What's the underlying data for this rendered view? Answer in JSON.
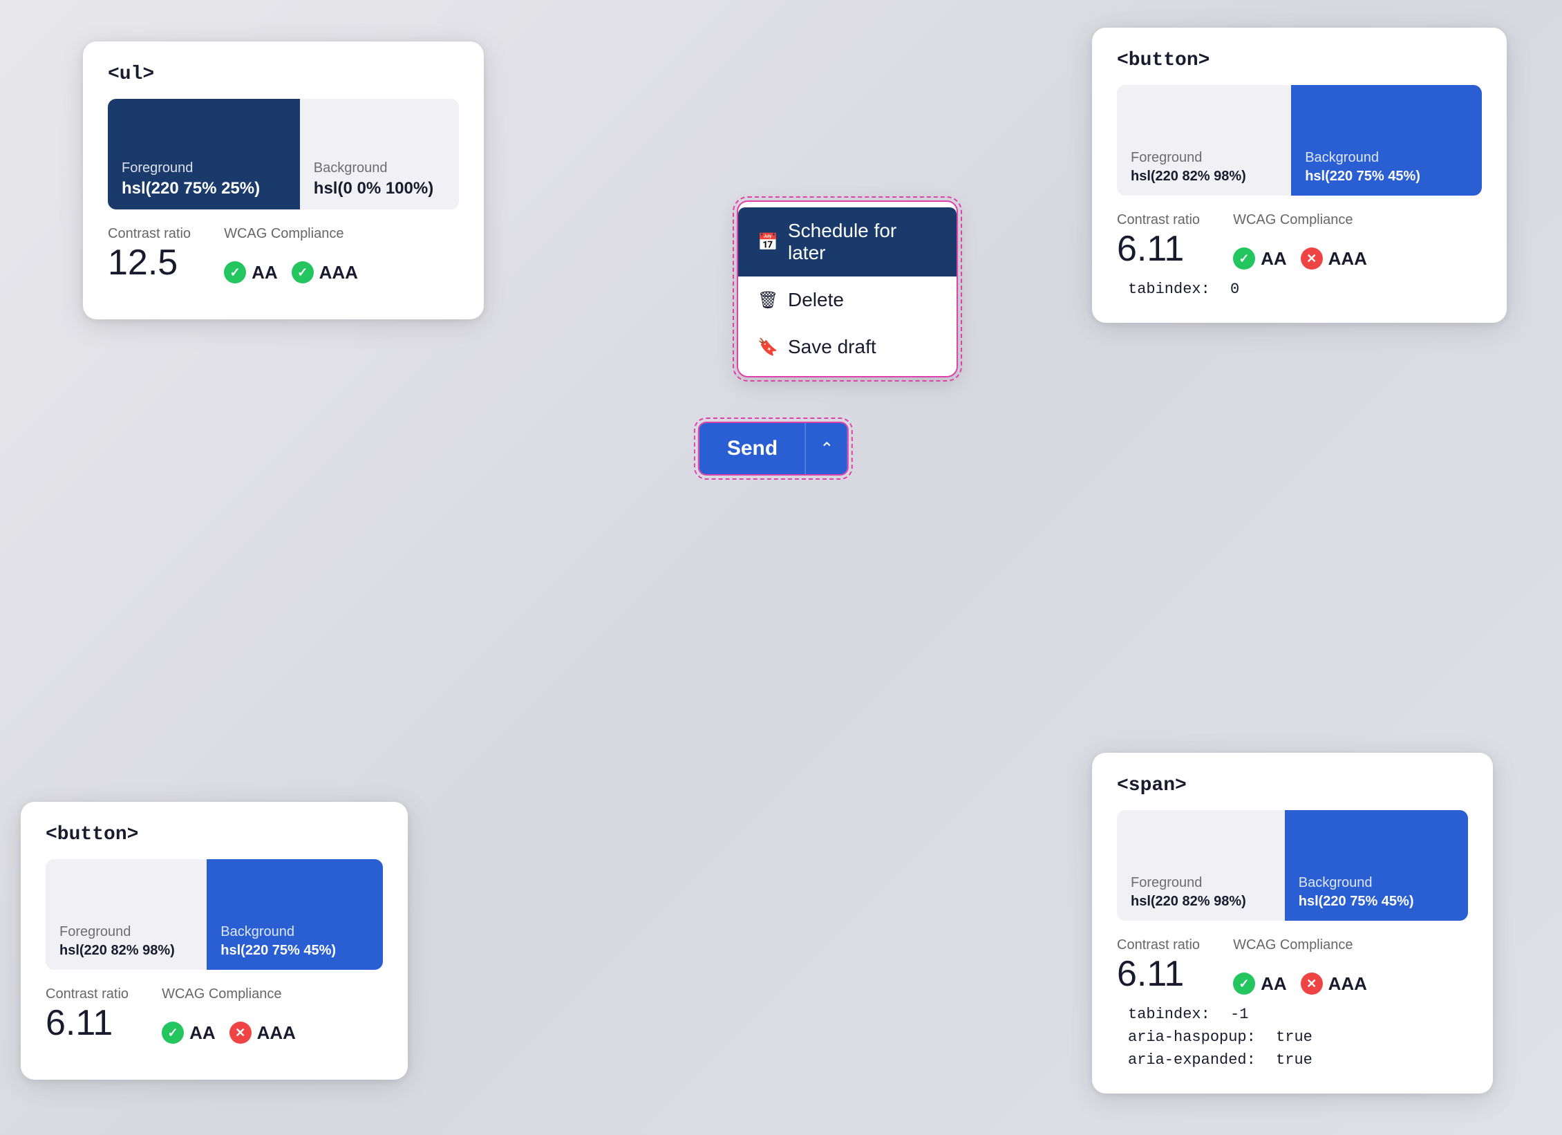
{
  "cards": {
    "ul_card": {
      "tag": "<ul>",
      "foreground_label": "Foreground",
      "foreground_value": "hsl(220 75% 25%)",
      "background_label": "Background",
      "background_value": "hsl(0 0% 100%)",
      "contrast_label": "Contrast ratio",
      "contrast_value": "12.5",
      "wcag_label": "WCAG Compliance",
      "wcag_aa": "AA",
      "wcag_aaa": "AAA",
      "aa_pass": true,
      "aaa_pass": true
    },
    "button_top_card": {
      "tag": "<button>",
      "foreground_label": "Foreground",
      "foreground_value": "hsl(220 82% 98%)",
      "background_label": "Background",
      "background_value": "hsl(220 75% 45%)",
      "contrast_label": "Contrast ratio",
      "contrast_value": "6.11",
      "wcag_label": "WCAG Compliance",
      "wcag_aa": "AA",
      "wcag_aaa": "AAA",
      "aa_pass": true,
      "aaa_pass": false,
      "tabindex_label": "tabindex:",
      "tabindex_value": "0"
    },
    "button_bottom_card": {
      "tag": "<button>",
      "foreground_label": "Foreground",
      "foreground_value": "hsl(220 82% 98%)",
      "background_label": "Background",
      "background_value": "hsl(220 75% 45%)",
      "contrast_label": "Contrast ratio",
      "contrast_value": "6.11",
      "wcag_label": "WCAG Compliance",
      "wcag_aa": "AA",
      "wcag_aaa": "AAA",
      "aa_pass": true,
      "aaa_pass": false
    },
    "span_card": {
      "tag": "<span>",
      "foreground_label": "Foreground",
      "foreground_value": "hsl(220 82% 98%)",
      "background_label": "Background",
      "background_value": "hsl(220 75% 45%)",
      "contrast_label": "Contrast ratio",
      "contrast_value": "6.11",
      "wcag_label": "WCAG Compliance",
      "wcag_aa": "AA",
      "wcag_aaa": "AAA",
      "aa_pass": true,
      "aaa_pass": false,
      "tabindex_label": "tabindex:",
      "tabindex_value": "-1",
      "aria_haspopup_label": "aria-haspopup:",
      "aria_haspopup_value": "true",
      "aria_expanded_label": "aria-expanded:",
      "aria_expanded_value": "true"
    }
  },
  "dropdown": {
    "items": [
      {
        "label": "Schedule for later",
        "icon": "calendar"
      },
      {
        "label": "Delete",
        "icon": "trash"
      },
      {
        "label": "Save draft",
        "icon": "bookmark"
      }
    ]
  },
  "send_button": {
    "label": "Send",
    "chevron": "chevron-up"
  }
}
